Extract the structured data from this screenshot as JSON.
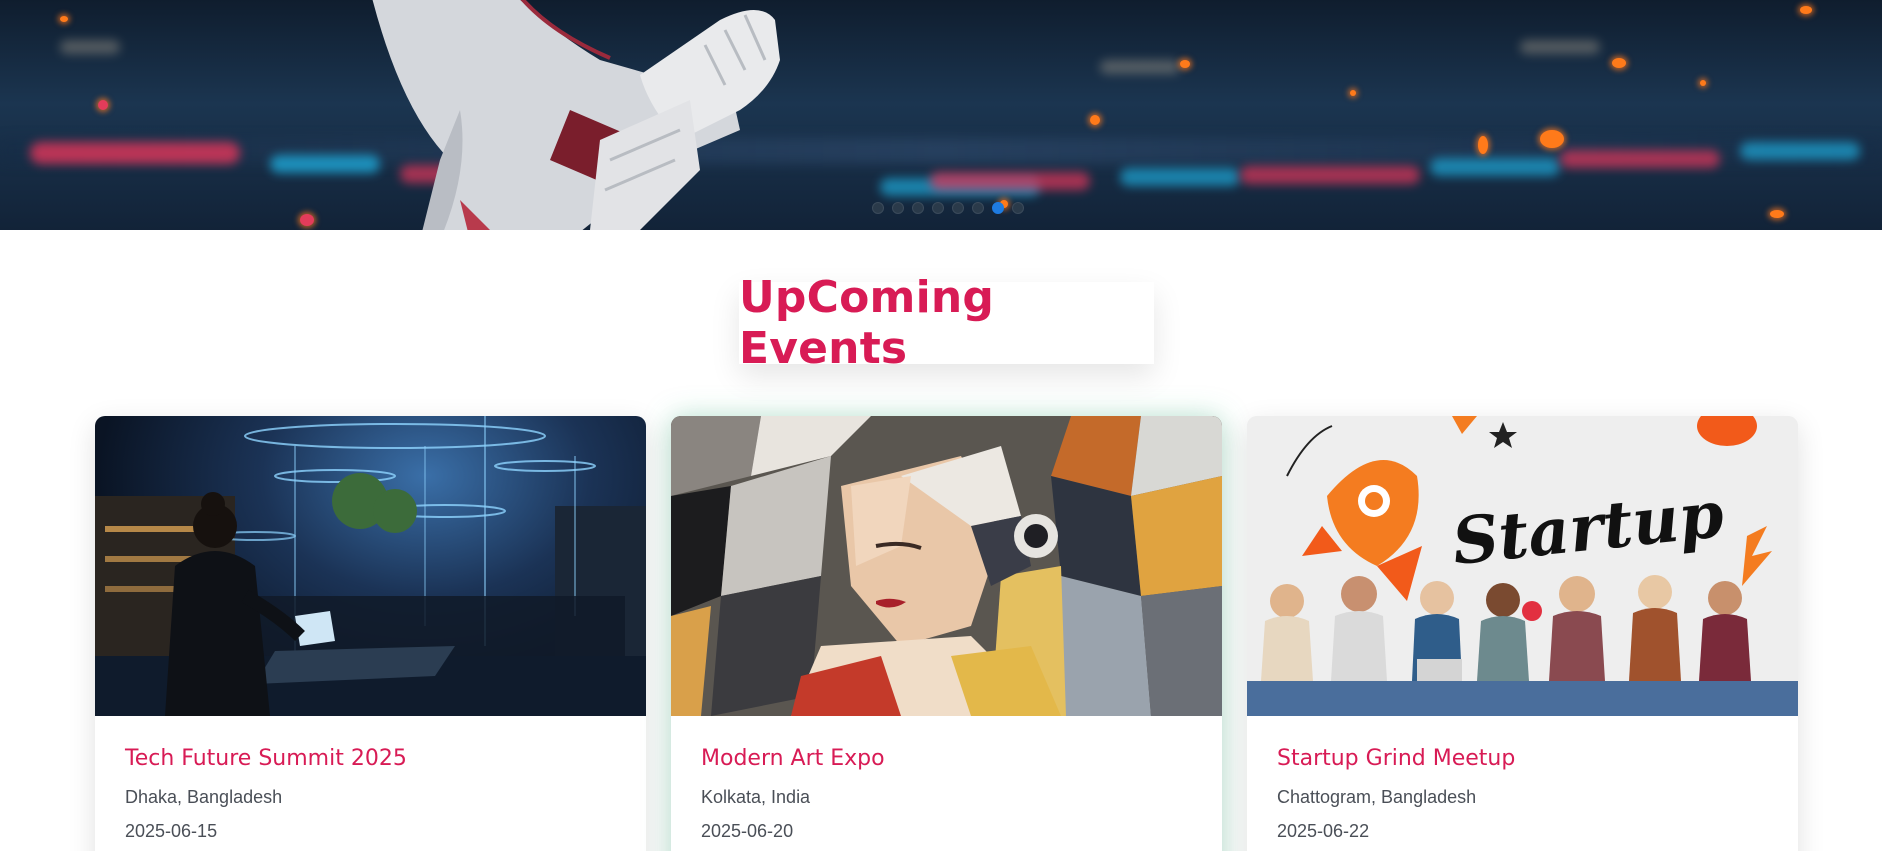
{
  "hero": {
    "slides_count": 8,
    "active_slide": 7
  },
  "section": {
    "title": "UpComing Events"
  },
  "events": [
    {
      "title": "Tech Future Summit 2025",
      "location": "Dhaka, Bangladesh",
      "date": "2025-06-15",
      "image_icon": "tech-city-image"
    },
    {
      "title": "Modern Art Expo",
      "location": "Kolkata, India",
      "date": "2025-06-20",
      "image_icon": "cubist-portrait-image"
    },
    {
      "title": "Startup Grind Meetup",
      "location": "Chattogram, Bangladesh",
      "date": "2025-06-22",
      "image_icon": "startup-team-image",
      "image_text": "Startup"
    }
  ],
  "colors": {
    "accent": "#d81b55",
    "active_dot": "#1e7be0",
    "card_glow": "#50c896"
  }
}
